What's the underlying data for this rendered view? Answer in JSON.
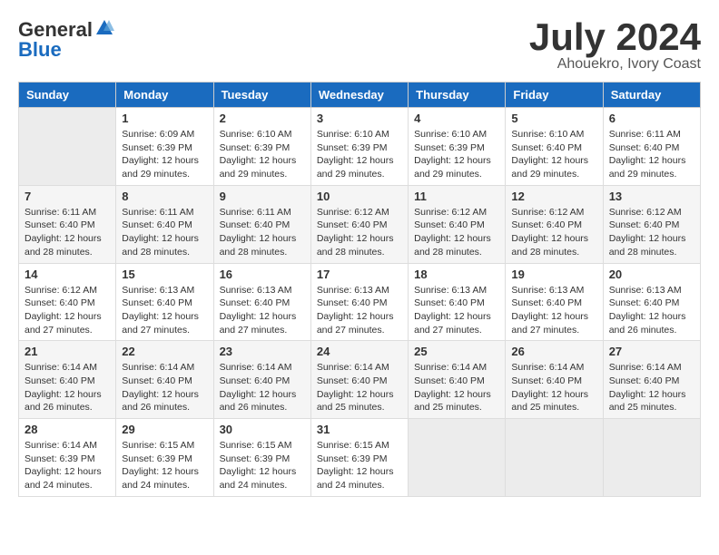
{
  "header": {
    "logo_general": "General",
    "logo_blue": "Blue",
    "month_title": "July 2024",
    "subtitle": "Ahouekro, Ivory Coast"
  },
  "days_of_week": [
    "Sunday",
    "Monday",
    "Tuesday",
    "Wednesday",
    "Thursday",
    "Friday",
    "Saturday"
  ],
  "weeks": [
    [
      {
        "day": "",
        "sunrise": "",
        "sunset": "",
        "daylight": "",
        "empty": true
      },
      {
        "day": "1",
        "sunrise": "Sunrise: 6:09 AM",
        "sunset": "Sunset: 6:39 PM",
        "daylight": "Daylight: 12 hours and 29 minutes."
      },
      {
        "day": "2",
        "sunrise": "Sunrise: 6:10 AM",
        "sunset": "Sunset: 6:39 PM",
        "daylight": "Daylight: 12 hours and 29 minutes."
      },
      {
        "day": "3",
        "sunrise": "Sunrise: 6:10 AM",
        "sunset": "Sunset: 6:39 PM",
        "daylight": "Daylight: 12 hours and 29 minutes."
      },
      {
        "day": "4",
        "sunrise": "Sunrise: 6:10 AM",
        "sunset": "Sunset: 6:39 PM",
        "daylight": "Daylight: 12 hours and 29 minutes."
      },
      {
        "day": "5",
        "sunrise": "Sunrise: 6:10 AM",
        "sunset": "Sunset: 6:40 PM",
        "daylight": "Daylight: 12 hours and 29 minutes."
      },
      {
        "day": "6",
        "sunrise": "Sunrise: 6:11 AM",
        "sunset": "Sunset: 6:40 PM",
        "daylight": "Daylight: 12 hours and 29 minutes."
      }
    ],
    [
      {
        "day": "7",
        "sunrise": "Sunrise: 6:11 AM",
        "sunset": "Sunset: 6:40 PM",
        "daylight": "Daylight: 12 hours and 28 minutes."
      },
      {
        "day": "8",
        "sunrise": "Sunrise: 6:11 AM",
        "sunset": "Sunset: 6:40 PM",
        "daylight": "Daylight: 12 hours and 28 minutes."
      },
      {
        "day": "9",
        "sunrise": "Sunrise: 6:11 AM",
        "sunset": "Sunset: 6:40 PM",
        "daylight": "Daylight: 12 hours and 28 minutes."
      },
      {
        "day": "10",
        "sunrise": "Sunrise: 6:12 AM",
        "sunset": "Sunset: 6:40 PM",
        "daylight": "Daylight: 12 hours and 28 minutes."
      },
      {
        "day": "11",
        "sunrise": "Sunrise: 6:12 AM",
        "sunset": "Sunset: 6:40 PM",
        "daylight": "Daylight: 12 hours and 28 minutes."
      },
      {
        "day": "12",
        "sunrise": "Sunrise: 6:12 AM",
        "sunset": "Sunset: 6:40 PM",
        "daylight": "Daylight: 12 hours and 28 minutes."
      },
      {
        "day": "13",
        "sunrise": "Sunrise: 6:12 AM",
        "sunset": "Sunset: 6:40 PM",
        "daylight": "Daylight: 12 hours and 28 minutes."
      }
    ],
    [
      {
        "day": "14",
        "sunrise": "Sunrise: 6:12 AM",
        "sunset": "Sunset: 6:40 PM",
        "daylight": "Daylight: 12 hours and 27 minutes."
      },
      {
        "day": "15",
        "sunrise": "Sunrise: 6:13 AM",
        "sunset": "Sunset: 6:40 PM",
        "daylight": "Daylight: 12 hours and 27 minutes."
      },
      {
        "day": "16",
        "sunrise": "Sunrise: 6:13 AM",
        "sunset": "Sunset: 6:40 PM",
        "daylight": "Daylight: 12 hours and 27 minutes."
      },
      {
        "day": "17",
        "sunrise": "Sunrise: 6:13 AM",
        "sunset": "Sunset: 6:40 PM",
        "daylight": "Daylight: 12 hours and 27 minutes."
      },
      {
        "day": "18",
        "sunrise": "Sunrise: 6:13 AM",
        "sunset": "Sunset: 6:40 PM",
        "daylight": "Daylight: 12 hours and 27 minutes."
      },
      {
        "day": "19",
        "sunrise": "Sunrise: 6:13 AM",
        "sunset": "Sunset: 6:40 PM",
        "daylight": "Daylight: 12 hours and 27 minutes."
      },
      {
        "day": "20",
        "sunrise": "Sunrise: 6:13 AM",
        "sunset": "Sunset: 6:40 PM",
        "daylight": "Daylight: 12 hours and 26 minutes."
      }
    ],
    [
      {
        "day": "21",
        "sunrise": "Sunrise: 6:14 AM",
        "sunset": "Sunset: 6:40 PM",
        "daylight": "Daylight: 12 hours and 26 minutes."
      },
      {
        "day": "22",
        "sunrise": "Sunrise: 6:14 AM",
        "sunset": "Sunset: 6:40 PM",
        "daylight": "Daylight: 12 hours and 26 minutes."
      },
      {
        "day": "23",
        "sunrise": "Sunrise: 6:14 AM",
        "sunset": "Sunset: 6:40 PM",
        "daylight": "Daylight: 12 hours and 26 minutes."
      },
      {
        "day": "24",
        "sunrise": "Sunrise: 6:14 AM",
        "sunset": "Sunset: 6:40 PM",
        "daylight": "Daylight: 12 hours and 25 minutes."
      },
      {
        "day": "25",
        "sunrise": "Sunrise: 6:14 AM",
        "sunset": "Sunset: 6:40 PM",
        "daylight": "Daylight: 12 hours and 25 minutes."
      },
      {
        "day": "26",
        "sunrise": "Sunrise: 6:14 AM",
        "sunset": "Sunset: 6:40 PM",
        "daylight": "Daylight: 12 hours and 25 minutes."
      },
      {
        "day": "27",
        "sunrise": "Sunrise: 6:14 AM",
        "sunset": "Sunset: 6:40 PM",
        "daylight": "Daylight: 12 hours and 25 minutes."
      }
    ],
    [
      {
        "day": "28",
        "sunrise": "Sunrise: 6:14 AM",
        "sunset": "Sunset: 6:39 PM",
        "daylight": "Daylight: 12 hours and 24 minutes."
      },
      {
        "day": "29",
        "sunrise": "Sunrise: 6:15 AM",
        "sunset": "Sunset: 6:39 PM",
        "daylight": "Daylight: 12 hours and 24 minutes."
      },
      {
        "day": "30",
        "sunrise": "Sunrise: 6:15 AM",
        "sunset": "Sunset: 6:39 PM",
        "daylight": "Daylight: 12 hours and 24 minutes."
      },
      {
        "day": "31",
        "sunrise": "Sunrise: 6:15 AM",
        "sunset": "Sunset: 6:39 PM",
        "daylight": "Daylight: 12 hours and 24 minutes."
      },
      {
        "day": "",
        "sunrise": "",
        "sunset": "",
        "daylight": "",
        "empty": true
      },
      {
        "day": "",
        "sunrise": "",
        "sunset": "",
        "daylight": "",
        "empty": true
      },
      {
        "day": "",
        "sunrise": "",
        "sunset": "",
        "daylight": "",
        "empty": true
      }
    ]
  ]
}
